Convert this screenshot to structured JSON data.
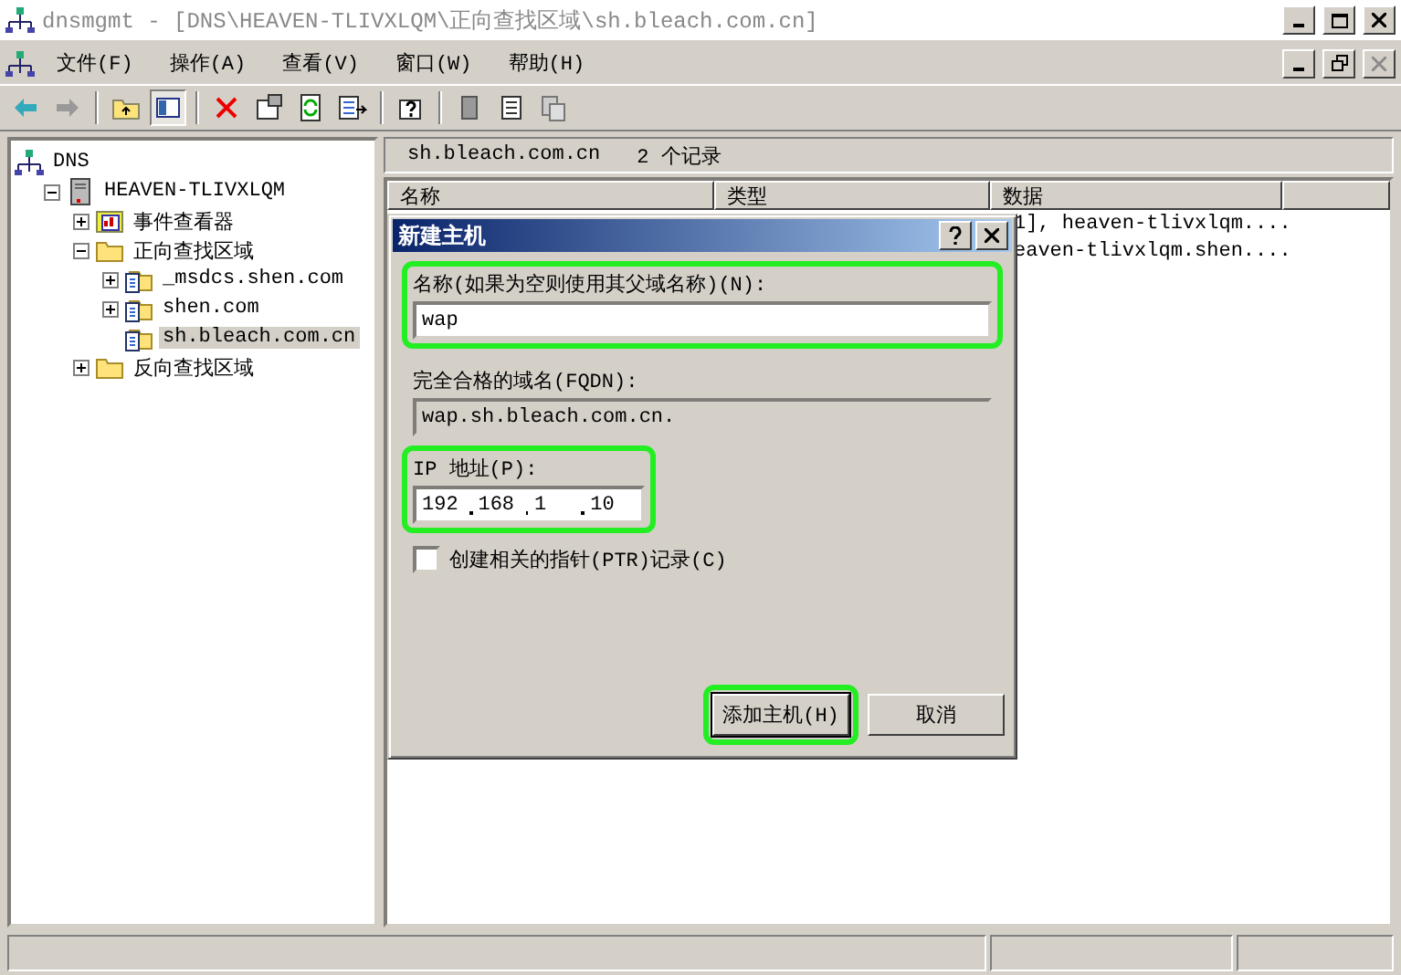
{
  "window": {
    "title": "dnsmgmt - [DNS\\HEAVEN-TLIVXLQM\\正向查找区域\\sh.bleach.com.cn]"
  },
  "menu": [
    {
      "label": "文件(F)"
    },
    {
      "label": "操作(A)"
    },
    {
      "label": "查看(V)"
    },
    {
      "label": "窗口(W)"
    },
    {
      "label": "帮助(H)"
    }
  ],
  "tree": [
    {
      "label": "DNS",
      "kind": "dns",
      "selected": false,
      "children": [
        {
          "label": "HEAVEN-TLIVXLQM",
          "kind": "server",
          "expanded": true,
          "selected": false,
          "children": [
            {
              "label": "事件查看器",
              "kind": "event",
              "expanded": false,
              "selected": false
            },
            {
              "label": "正向查找区域",
              "kind": "folder",
              "expanded": true,
              "selected": false,
              "children": [
                {
                  "label": "_msdcs.shen.com",
                  "kind": "zone",
                  "expanded": false,
                  "selected": false
                },
                {
                  "label": "shen.com",
                  "kind": "zone",
                  "expanded": false,
                  "selected": false
                },
                {
                  "label": "sh.bleach.com.cn",
                  "kind": "zone",
                  "selected": true
                }
              ]
            },
            {
              "label": "反向查找区域",
              "kind": "folder",
              "expanded": false,
              "selected": false
            }
          ]
        }
      ]
    }
  ],
  "details": {
    "zone": "sh.bleach.com.cn",
    "count": "2 个记录",
    "columns": [
      "名称",
      "类型",
      "数据"
    ],
    "rows": [
      {
        "data": "1], heaven-tlivxlqm...."
      },
      {
        "data": "eaven-tlivxlqm.shen...."
      }
    ]
  },
  "dialog": {
    "title": "新建主机",
    "name_label": "名称(如果为空则使用其父域名称)(N):",
    "name_value": "wap",
    "name_highlighted": true,
    "fqdn_label": "完全合格的域名(FQDN):",
    "fqdn_value": "wap.sh.bleach.com.cn.",
    "ip_label": "IP 地址(P):",
    "ip_octets": [
      "192",
      "168",
      "1",
      "10"
    ],
    "ip_highlighted": true,
    "ptr": {
      "label": "创建相关的指针(PTR)记录(C)",
      "checked": false
    },
    "buttons": [
      {
        "label": "添加主机(H)",
        "default": true,
        "highlighted": true
      },
      {
        "label": "取消",
        "default": false,
        "highlighted": false
      }
    ]
  }
}
